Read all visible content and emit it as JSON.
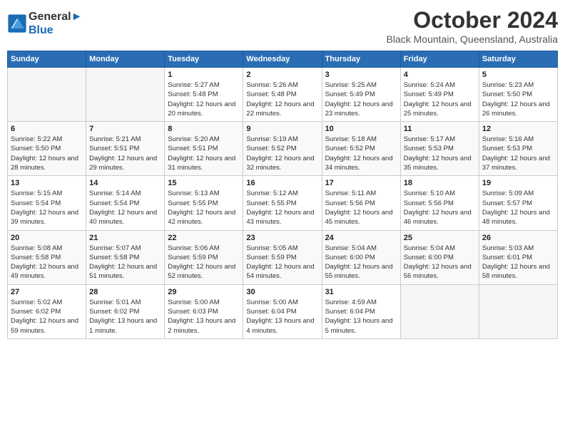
{
  "header": {
    "logo_line1": "General",
    "logo_line2": "Blue",
    "month": "October 2024",
    "location": "Black Mountain, Queensland, Australia"
  },
  "weekdays": [
    "Sunday",
    "Monday",
    "Tuesday",
    "Wednesday",
    "Thursday",
    "Friday",
    "Saturday"
  ],
  "weeks": [
    [
      {
        "day": "",
        "sunrise": "",
        "sunset": "",
        "daylight": ""
      },
      {
        "day": "",
        "sunrise": "",
        "sunset": "",
        "daylight": ""
      },
      {
        "day": "1",
        "sunrise": "Sunrise: 5:27 AM",
        "sunset": "Sunset: 5:48 PM",
        "daylight": "Daylight: 12 hours and 20 minutes."
      },
      {
        "day": "2",
        "sunrise": "Sunrise: 5:26 AM",
        "sunset": "Sunset: 5:48 PM",
        "daylight": "Daylight: 12 hours and 22 minutes."
      },
      {
        "day": "3",
        "sunrise": "Sunrise: 5:25 AM",
        "sunset": "Sunset: 5:49 PM",
        "daylight": "Daylight: 12 hours and 23 minutes."
      },
      {
        "day": "4",
        "sunrise": "Sunrise: 5:24 AM",
        "sunset": "Sunset: 5:49 PM",
        "daylight": "Daylight: 12 hours and 25 minutes."
      },
      {
        "day": "5",
        "sunrise": "Sunrise: 5:23 AM",
        "sunset": "Sunset: 5:50 PM",
        "daylight": "Daylight: 12 hours and 26 minutes."
      }
    ],
    [
      {
        "day": "6",
        "sunrise": "Sunrise: 5:22 AM",
        "sunset": "Sunset: 5:50 PM",
        "daylight": "Daylight: 12 hours and 28 minutes."
      },
      {
        "day": "7",
        "sunrise": "Sunrise: 5:21 AM",
        "sunset": "Sunset: 5:51 PM",
        "daylight": "Daylight: 12 hours and 29 minutes."
      },
      {
        "day": "8",
        "sunrise": "Sunrise: 5:20 AM",
        "sunset": "Sunset: 5:51 PM",
        "daylight": "Daylight: 12 hours and 31 minutes."
      },
      {
        "day": "9",
        "sunrise": "Sunrise: 5:19 AM",
        "sunset": "Sunset: 5:52 PM",
        "daylight": "Daylight: 12 hours and 32 minutes."
      },
      {
        "day": "10",
        "sunrise": "Sunrise: 5:18 AM",
        "sunset": "Sunset: 5:52 PM",
        "daylight": "Daylight: 12 hours and 34 minutes."
      },
      {
        "day": "11",
        "sunrise": "Sunrise: 5:17 AM",
        "sunset": "Sunset: 5:53 PM",
        "daylight": "Daylight: 12 hours and 35 minutes."
      },
      {
        "day": "12",
        "sunrise": "Sunrise: 5:16 AM",
        "sunset": "Sunset: 5:53 PM",
        "daylight": "Daylight: 12 hours and 37 minutes."
      }
    ],
    [
      {
        "day": "13",
        "sunrise": "Sunrise: 5:15 AM",
        "sunset": "Sunset: 5:54 PM",
        "daylight": "Daylight: 12 hours and 39 minutes."
      },
      {
        "day": "14",
        "sunrise": "Sunrise: 5:14 AM",
        "sunset": "Sunset: 5:54 PM",
        "daylight": "Daylight: 12 hours and 40 minutes."
      },
      {
        "day": "15",
        "sunrise": "Sunrise: 5:13 AM",
        "sunset": "Sunset: 5:55 PM",
        "daylight": "Daylight: 12 hours and 42 minutes."
      },
      {
        "day": "16",
        "sunrise": "Sunrise: 5:12 AM",
        "sunset": "Sunset: 5:55 PM",
        "daylight": "Daylight: 12 hours and 43 minutes."
      },
      {
        "day": "17",
        "sunrise": "Sunrise: 5:11 AM",
        "sunset": "Sunset: 5:56 PM",
        "daylight": "Daylight: 12 hours and 45 minutes."
      },
      {
        "day": "18",
        "sunrise": "Sunrise: 5:10 AM",
        "sunset": "Sunset: 5:56 PM",
        "daylight": "Daylight: 12 hours and 46 minutes."
      },
      {
        "day": "19",
        "sunrise": "Sunrise: 5:09 AM",
        "sunset": "Sunset: 5:57 PM",
        "daylight": "Daylight: 12 hours and 48 minutes."
      }
    ],
    [
      {
        "day": "20",
        "sunrise": "Sunrise: 5:08 AM",
        "sunset": "Sunset: 5:58 PM",
        "daylight": "Daylight: 12 hours and 49 minutes."
      },
      {
        "day": "21",
        "sunrise": "Sunrise: 5:07 AM",
        "sunset": "Sunset: 5:58 PM",
        "daylight": "Daylight: 12 hours and 51 minutes."
      },
      {
        "day": "22",
        "sunrise": "Sunrise: 5:06 AM",
        "sunset": "Sunset: 5:59 PM",
        "daylight": "Daylight: 12 hours and 52 minutes."
      },
      {
        "day": "23",
        "sunrise": "Sunrise: 5:05 AM",
        "sunset": "Sunset: 5:59 PM",
        "daylight": "Daylight: 12 hours and 54 minutes."
      },
      {
        "day": "24",
        "sunrise": "Sunrise: 5:04 AM",
        "sunset": "Sunset: 6:00 PM",
        "daylight": "Daylight: 12 hours and 55 minutes."
      },
      {
        "day": "25",
        "sunrise": "Sunrise: 5:04 AM",
        "sunset": "Sunset: 6:00 PM",
        "daylight": "Daylight: 12 hours and 56 minutes."
      },
      {
        "day": "26",
        "sunrise": "Sunrise: 5:03 AM",
        "sunset": "Sunset: 6:01 PM",
        "daylight": "Daylight: 12 hours and 58 minutes."
      }
    ],
    [
      {
        "day": "27",
        "sunrise": "Sunrise: 5:02 AM",
        "sunset": "Sunset: 6:02 PM",
        "daylight": "Daylight: 12 hours and 59 minutes."
      },
      {
        "day": "28",
        "sunrise": "Sunrise: 5:01 AM",
        "sunset": "Sunset: 6:02 PM",
        "daylight": "Daylight: 13 hours and 1 minute."
      },
      {
        "day": "29",
        "sunrise": "Sunrise: 5:00 AM",
        "sunset": "Sunset: 6:03 PM",
        "daylight": "Daylight: 13 hours and 2 minutes."
      },
      {
        "day": "30",
        "sunrise": "Sunrise: 5:00 AM",
        "sunset": "Sunset: 6:04 PM",
        "daylight": "Daylight: 13 hours and 4 minutes."
      },
      {
        "day": "31",
        "sunrise": "Sunrise: 4:59 AM",
        "sunset": "Sunset: 6:04 PM",
        "daylight": "Daylight: 13 hours and 5 minutes."
      },
      {
        "day": "",
        "sunrise": "",
        "sunset": "",
        "daylight": ""
      },
      {
        "day": "",
        "sunrise": "",
        "sunset": "",
        "daylight": ""
      }
    ]
  ]
}
